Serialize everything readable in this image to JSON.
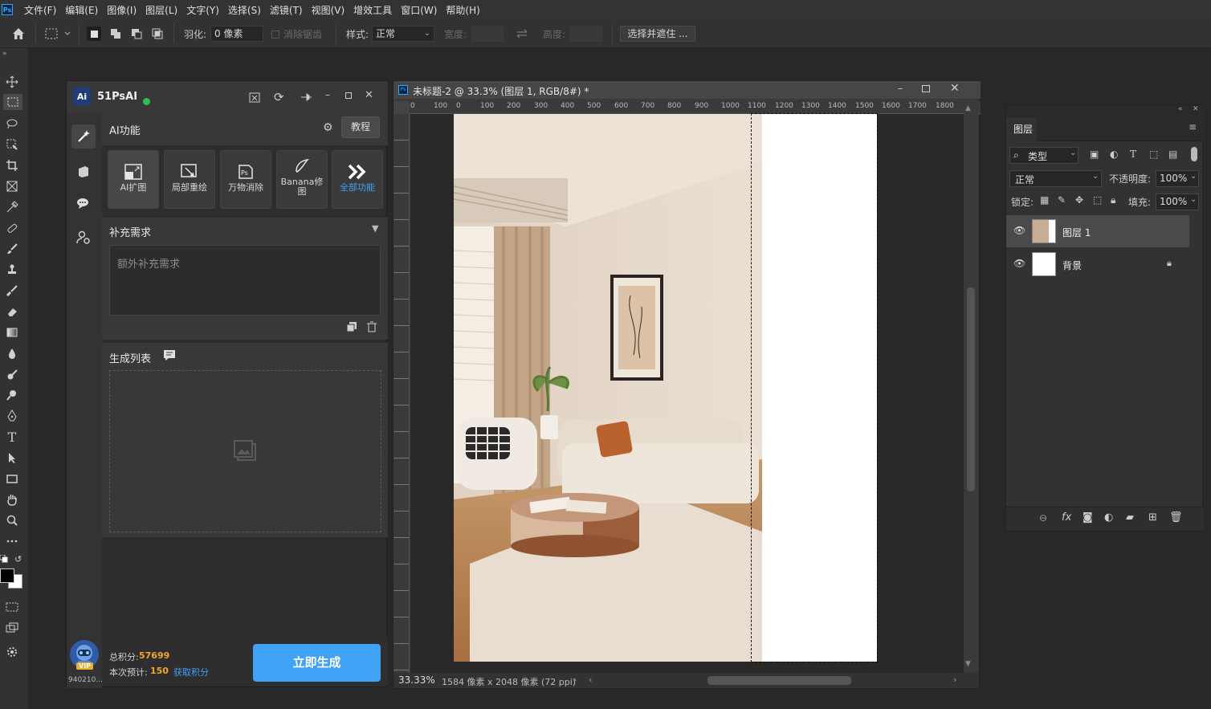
{
  "menu": {
    "logo": "Ps",
    "items": [
      "文件(F)",
      "编辑(E)",
      "图像(I)",
      "图层(L)",
      "文字(Y)",
      "选择(S)",
      "滤镜(T)",
      "视图(V)",
      "增效工具",
      "窗口(W)",
      "帮助(H)"
    ]
  },
  "options": {
    "feather_label": "羽化:",
    "feather_value": "0 像素",
    "antialias_label": "消除锯齿",
    "style_label": "样式:",
    "style_value": "正常",
    "width_label": "宽度:",
    "height_label": "高度:",
    "select_mask_label": "选择并遮住 ..."
  },
  "plugin": {
    "title": "51PsAI",
    "ai_section_title": "AI功能",
    "tutorial_button": "教程",
    "features": [
      "AI扩图",
      "局部重绘",
      "万物消除",
      "Banana修图",
      "全部功能"
    ],
    "supplement_title": "补充需求",
    "supplement_placeholder": "额外补充需求",
    "gen_list_title": "生成列表",
    "total_points_label": "总积分:",
    "total_points_value": "57699",
    "estimate_label": "本次预计:",
    "estimate_value": "150",
    "get_points_link": "获取积分",
    "generate_button": "立即生成",
    "user_id": "940210...",
    "vip_badge": "VIP"
  },
  "document": {
    "title": "未标题-2 @ 33.3% (图层 1, RGB/8#) *",
    "ruler_ticks": [
      "0",
      "100",
      "0",
      "100",
      "200",
      "300",
      "400",
      "500",
      "600",
      "700",
      "800",
      "900",
      "1000",
      "1100",
      "1200",
      "1300",
      "1400",
      "1500",
      "1600",
      "1700",
      "1800"
    ],
    "zoom": "33.33%",
    "size_info": "1584 像素 x 2048 像素 (72 ppi)"
  },
  "layers_panel": {
    "tab": "图层",
    "filter_kind": "类型",
    "blend_mode": "正常",
    "opacity_label": "不透明度:",
    "opacity_value": "100%",
    "lock_label": "锁定:",
    "fill_label": "填充:",
    "fill_value": "100%",
    "layers": [
      {
        "name": "图层 1",
        "selected": true
      },
      {
        "name": "背景",
        "locked": true
      }
    ]
  },
  "colors": {
    "accent_blue": "#3fa2f7",
    "points_orange": "#f5a623",
    "status_green": "#2ec04f"
  }
}
